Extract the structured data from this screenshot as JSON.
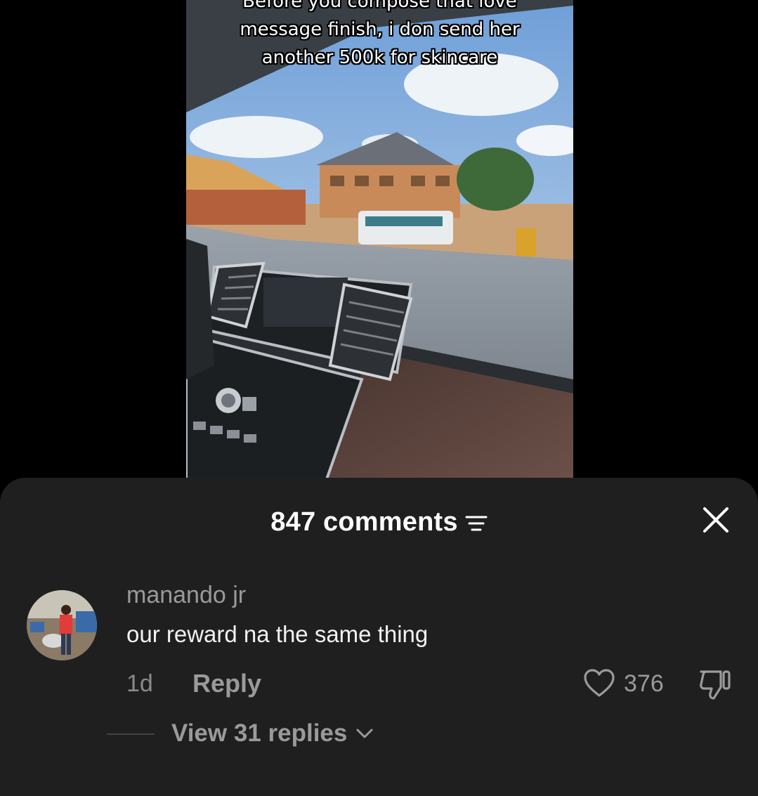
{
  "video": {
    "caption_lines": [
      "Before you compose that love",
      "message finish, i don send her",
      "another 500k for skincare"
    ]
  },
  "comments_sheet": {
    "title": "847 comments",
    "sort_icon": "filter-lines-icon",
    "close_icon": "close-icon",
    "comment": {
      "username": "manando jr",
      "text": "our reward na the same thing",
      "age": "1d",
      "reply_label": "Reply",
      "like_icon": "heart-outline-icon",
      "like_count": "376",
      "dislike_icon": "thumbs-down-icon"
    },
    "view_replies_label": "View 31 replies",
    "view_replies_icon": "chevron-down-icon"
  },
  "colors": {
    "sheet_background": "#1f1f1f",
    "page_background": "#000000",
    "secondary_text": "#9a9a9a"
  }
}
